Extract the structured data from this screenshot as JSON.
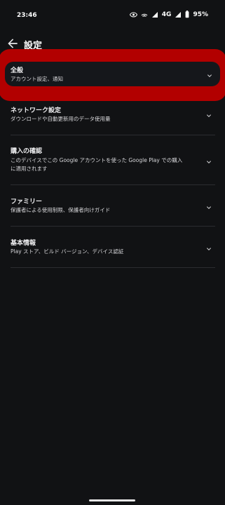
{
  "status_bar": {
    "time": "23:46",
    "network": "4G",
    "battery": "95%"
  },
  "header": {
    "title": "設定"
  },
  "settings": [
    {
      "label": "全般",
      "sub": "アカウント設定、通知"
    },
    {
      "label": "ネットワーク設定",
      "sub": "ダウンロードや自動更新用のデータ使用量"
    },
    {
      "label": "購入の確認",
      "sub": "このデバイスでこの Google アカウントを使った Google Play での購入\nに適用されます"
    },
    {
      "label": "ファミリー",
      "sub": "保護者による使用制限、保護者向けガイド"
    },
    {
      "label": "基本情報",
      "sub": "Play ストア、ビルド バージョン、デバイス認証"
    }
  ],
  "colors": {
    "background": "#111214",
    "highlight": "#b20000"
  }
}
